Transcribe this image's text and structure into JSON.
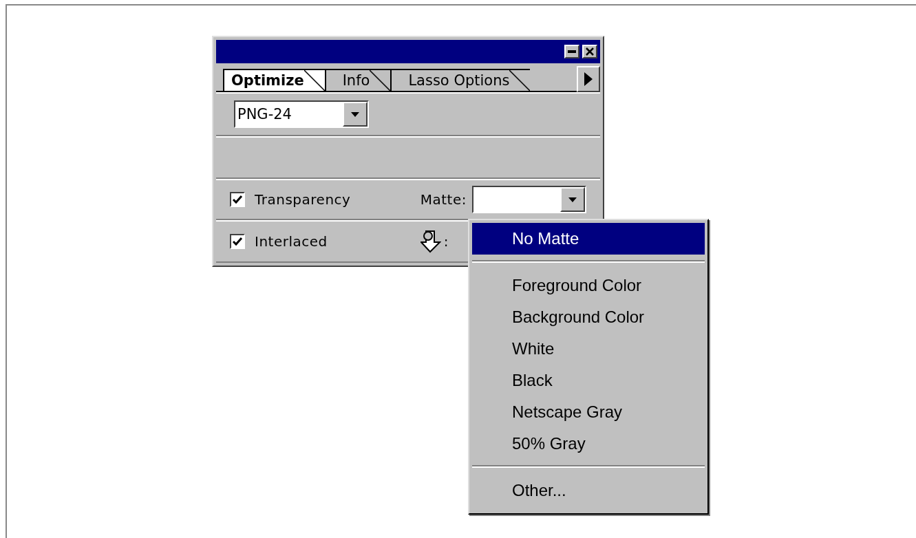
{
  "panel": {
    "tabs": [
      {
        "label": "Optimize",
        "selected": true
      },
      {
        "label": "Info",
        "selected": false
      },
      {
        "label": "Lasso Options",
        "selected": false
      }
    ],
    "format": {
      "value": "PNG-24"
    },
    "options": [
      {
        "label": "Transparency",
        "checked": true
      },
      {
        "label": "Interlaced",
        "checked": true
      }
    ],
    "matte": {
      "label": "Matte:"
    },
    "dither_label": ":"
  },
  "menu": {
    "items": [
      {
        "kind": "item",
        "label": "No Matte",
        "selected": true
      },
      {
        "kind": "separator"
      },
      {
        "kind": "item",
        "label": "Foreground Color",
        "selected": false
      },
      {
        "kind": "item",
        "label": "Background Color",
        "selected": false
      },
      {
        "kind": "item",
        "label": "White",
        "selected": false
      },
      {
        "kind": "item",
        "label": "Black",
        "selected": false
      },
      {
        "kind": "item",
        "label": "Netscape Gray",
        "selected": false
      },
      {
        "kind": "item",
        "label": "50% Gray",
        "selected": false
      },
      {
        "kind": "separator"
      },
      {
        "kind": "item",
        "label": "Other...",
        "selected": false
      }
    ]
  }
}
